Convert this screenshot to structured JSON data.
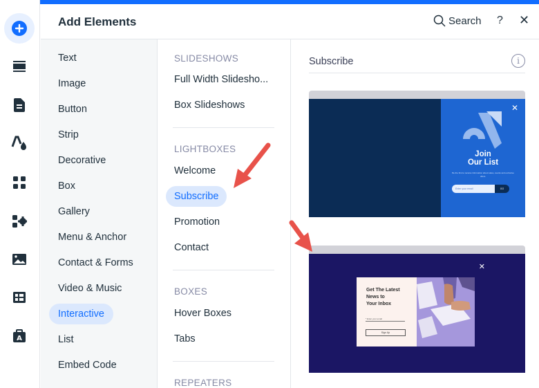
{
  "panel": {
    "title": "Add Elements",
    "search_label": "Search",
    "help_label": "?",
    "close_label": "✕"
  },
  "rail": {
    "icons": [
      "add-icon",
      "strip-icon",
      "page-icon",
      "theme-icon",
      "apps-grid-icon",
      "app-settings-icon",
      "media-icon",
      "cms-table-icon",
      "business-icon"
    ],
    "accent": "#116dff"
  },
  "categories": [
    {
      "label": "Text"
    },
    {
      "label": "Image"
    },
    {
      "label": "Button"
    },
    {
      "label": "Strip"
    },
    {
      "label": "Decorative"
    },
    {
      "label": "Box"
    },
    {
      "label": "Gallery"
    },
    {
      "label": "Menu & Anchor"
    },
    {
      "label": "Contact & Forms"
    },
    {
      "label": "Video & Music"
    },
    {
      "label": "Interactive",
      "active": true
    },
    {
      "label": "List"
    },
    {
      "label": "Embed Code"
    }
  ],
  "subcategories": {
    "sections": [
      {
        "heading": "SLIDESHOWS",
        "items": [
          "Full Width Slidesho...",
          "Box Slideshows"
        ]
      },
      {
        "heading": "LIGHTBOXES",
        "items": [
          "Welcome",
          "Subscribe",
          "Promotion",
          "Contact"
        ],
        "active": "Subscribe"
      },
      {
        "heading": "BOXES",
        "items": [
          "Hover Boxes",
          "Tabs"
        ]
      },
      {
        "heading": "REPEATERS",
        "items": []
      }
    ]
  },
  "preview": {
    "title": "Subscribe",
    "info_icon": "i",
    "cards": [
      {
        "heading_line1": "Join",
        "heading_line2": "Our List",
        "body": "Be the first to receive information about sales, events and exclusive offers.",
        "email_placeholder": "Enter your email",
        "button": "GO",
        "close": "✕",
        "colors": {
          "left": "#0b2c55",
          "right": "#1e66d2"
        }
      },
      {
        "heading_line1": "Get The Latest",
        "heading_line2": "News to",
        "heading_line3": "Your Inbox",
        "email_placeholder": "* Enter your email",
        "button": "Sign Up",
        "close": "✕",
        "colors": {
          "background": "#1b1664",
          "panel": "#fcf2ee",
          "image": "#9b8fd8"
        }
      }
    ]
  }
}
